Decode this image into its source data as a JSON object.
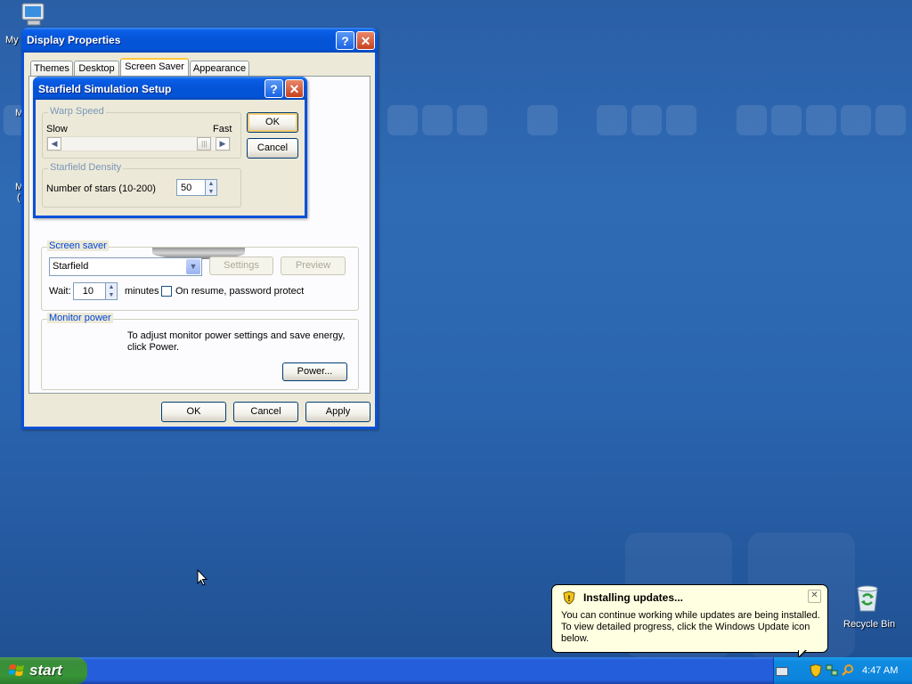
{
  "desktop": {
    "icons": [
      {
        "label": "My"
      },
      {
        "label": "Recycle Bin"
      }
    ],
    "stray_letters": [
      "M",
      "M",
      "("
    ]
  },
  "display_properties": {
    "title": "Display Properties",
    "tabs": [
      "Themes",
      "Desktop",
      "Screen Saver",
      "Appearance"
    ],
    "selected_tab": "Screen Saver",
    "screen_saver_group": "Screen saver",
    "screen_saver_value": "Starfield",
    "settings_label": "Settings",
    "preview_label": "Preview",
    "wait_label": "Wait:",
    "wait_value": "10",
    "minutes_label": "minutes",
    "password_label": "On resume, password protect",
    "password_checked": false,
    "monitor_group": "Monitor power",
    "monitor_text": "To adjust monitor power settings and save energy, click Power.",
    "power_label": "Power...",
    "ok_label": "OK",
    "cancel_label": "Cancel",
    "apply_label": "Apply"
  },
  "starfield_dialog": {
    "title": "Starfield Simulation Setup",
    "warp_group": "Warp Speed",
    "slow_label": "Slow",
    "fast_label": "Fast",
    "warp_speed_fraction": 0.97,
    "density_group": "Starfield Density",
    "stars_label": "Number of stars (10-200)",
    "stars_value": "50",
    "ok_label": "OK",
    "cancel_label": "Cancel"
  },
  "balloon": {
    "title": "Installing updates...",
    "text": "You can continue working while updates are being installed. To view detailed progress, click the Windows Update icon below."
  },
  "taskbar": {
    "start_label": "start",
    "clock": "4:47 AM"
  },
  "colors": {
    "desktop": "#2a64ae",
    "title_bar": "#0553d6",
    "dialog_face": "#ece9d8",
    "start_green": "#379437",
    "group_label": "#0046d5"
  }
}
